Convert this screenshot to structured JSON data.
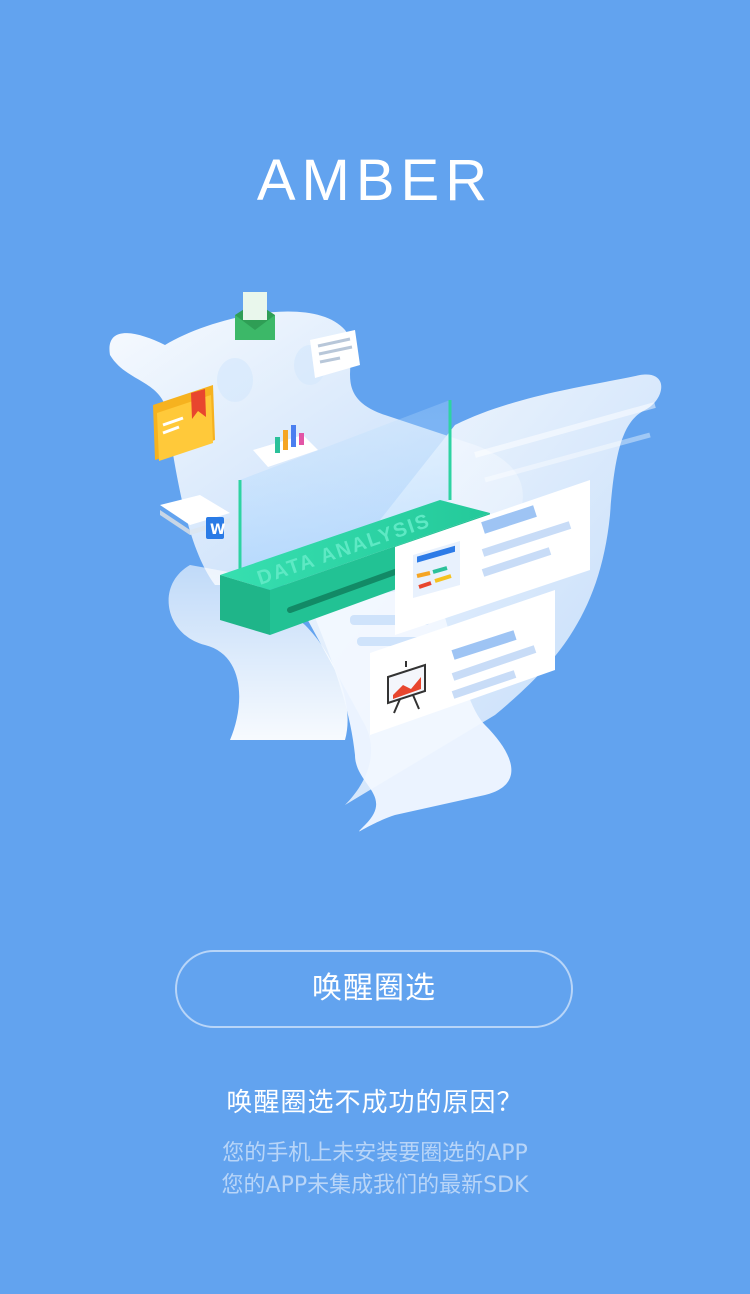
{
  "app": {
    "logo_text": "AMBER"
  },
  "illustration": {
    "machine_label": "DATA ANALYSIS",
    "icons": [
      "mail-icon",
      "folder-bookmark-icon",
      "bar-chart-card-icon",
      "document-stack-icon",
      "web-page-icon",
      "presentation-chart-icon"
    ]
  },
  "actions": {
    "wake_button_label": "唤醒圈选"
  },
  "help": {
    "title": "唤醒圈选不成功的原因？",
    "reasons": [
      "您的手机上未安装要圈选的APP",
      "您的APP未集成我们的最新SDK"
    ]
  },
  "colors": {
    "background": "#62a3ef",
    "machine_green": "#2ed3a2",
    "paper": "#eaf3ff"
  }
}
